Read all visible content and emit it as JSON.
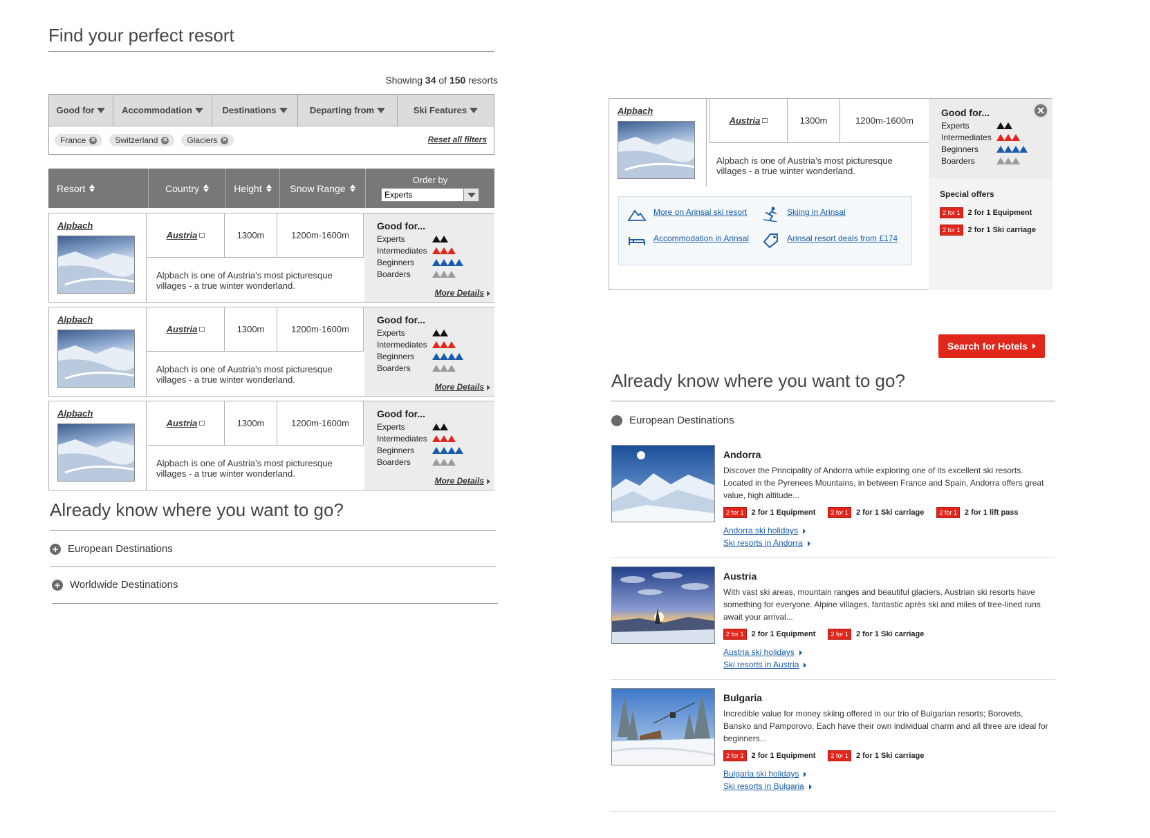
{
  "finder": {
    "title": "Find your perfect resort",
    "showing_prefix": "Showing",
    "showing_count": "34",
    "showing_of": "of",
    "showing_total": "150",
    "showing_suffix": "resorts",
    "filters": [
      "Good for",
      "Accommodation",
      "Destinations",
      "Departing from",
      "Ski Features"
    ],
    "chips": [
      "France",
      "Switzerland",
      "Glaciers"
    ],
    "reset_label": "Reset all filters",
    "columns": {
      "resort": "Resort",
      "country": "Country",
      "height": "Height",
      "snow": "Snow Range",
      "order_by": "Order by",
      "order_value": "Experts"
    }
  },
  "resorts": [
    {
      "name": "Alpbach",
      "country": "Austria",
      "height": "1300m",
      "snow_range": "1200m-1600m",
      "description": "Alpbach is one of Austria's most picturesque villages - a true winter wonderland.",
      "more": "More Details"
    },
    {
      "name": "Alpbach",
      "country": "Austria",
      "height": "1300m",
      "snow_range": "1200m-1600m",
      "description": "Alpbach is one of Austria's most picturesque villages - a true winter wonderland.",
      "more": "More Details"
    },
    {
      "name": "Alpbach",
      "country": "Austria",
      "height": "1300m",
      "snow_range": "1200m-1600m",
      "description": "Alpbach is one of Austria's most picturesque villages - a true winter wonderland.",
      "more": "More Details"
    }
  ],
  "good_for": {
    "title": "Good for...",
    "levels": [
      {
        "label": "Experts",
        "rating": 2,
        "color": "#111111"
      },
      {
        "label": "Intermediates",
        "rating": 3,
        "color": "#e1261c"
      },
      {
        "label": "Beginners",
        "rating": 4,
        "color": "#1a5ca8"
      },
      {
        "label": "Boarders",
        "rating": 3,
        "color": "#9a9a9a"
      }
    ]
  },
  "left_destinations": {
    "title": "Already know where you want to go?",
    "items": [
      "European Destinations",
      "Worldwide Destinations"
    ]
  },
  "popup": {
    "name": "Alpbach",
    "country": "Austria",
    "height": "1300m",
    "snow_range": "1200m-1600m",
    "description": "Alpbach is one of Austria's most picturesque villages - a true winter wonderland.",
    "links": {
      "more_on": "More on Arinsal ski resort",
      "skiing_in": "Skiing in Arinsal",
      "accommodation": "Accommodation in Arinsal",
      "deals": "Arinsal resort deals from £174"
    },
    "special_offers_title": "Special offers",
    "offers": [
      "2 for 1 Equipment",
      "2 for 1 Ski carriage"
    ],
    "badge": "2 for 1",
    "search_button": "Search for Hotels"
  },
  "right_destinations": {
    "title": "Already know where you want to go?",
    "section": "European Destinations",
    "items": [
      {
        "name": "Andorra",
        "text": "Discover the Principality of Andorra while exploring one of its excellent ski resorts. Located in the Pyrenees Mountains, in between France and Spain, Andorra offers great value, high altitude...",
        "offers": [
          "2 for 1 Equipment",
          "2 for 1 Ski carriage",
          "2 for 1 lift pass"
        ],
        "link1": "Andorra ski holidays",
        "link2": "Ski resorts in Andorra"
      },
      {
        "name": "Austria",
        "text": "With vast ski areas, mountain ranges and beautiful glaciers, Austrian ski resorts have something for everyone. Alpine villages, fantastic après ski and miles of tree-lined runs await your arrival...",
        "offers": [
          "2 for 1 Equipment",
          "2 for 1 Ski carriage"
        ],
        "link1": "Austria ski holidays",
        "link2": "Ski resorts in Austria"
      },
      {
        "name": "Bulgaria",
        "text": "Incredible value for money skiing offered in our trio of Bulgarian resorts; Borovets, Bansko and Pamporovo. Each have their own individual charm and all three are ideal for beginners...",
        "offers": [
          "2 for 1 Equipment",
          "2 for 1 Ski carriage"
        ],
        "link1": "Bulgaria ski holidays",
        "link2": "Ski resorts in Bulgaria"
      }
    ]
  }
}
